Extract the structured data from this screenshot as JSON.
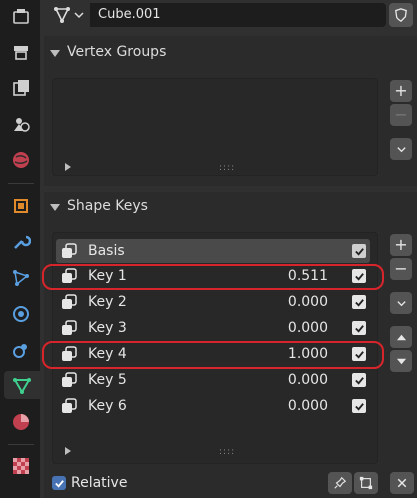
{
  "header": {
    "object_name": "Cube.001"
  },
  "tabs": [
    "tool-icon",
    "render-icon",
    "output-icon",
    "view-layer-icon",
    "scene-icon",
    "world-icon",
    "object-icon",
    "modifier-icon",
    "particles-icon",
    "physics-icon",
    "constraints-icon",
    "data-icon",
    "material-icon",
    "texture-icon"
  ],
  "vertex_groups": {
    "title": "Vertex Groups",
    "add": "+",
    "remove": "−",
    "menu": "⌄",
    "grip": "::::"
  },
  "shape_keys": {
    "title": "Shape Keys",
    "add": "+",
    "remove": "−",
    "grip": "::::",
    "rows": [
      {
        "name": "Basis",
        "value": "",
        "checked": true,
        "selected": true
      },
      {
        "name": "Key 1",
        "value": "0.511",
        "checked": true,
        "selected": false
      },
      {
        "name": "Key 2",
        "value": "0.000",
        "checked": true,
        "selected": false
      },
      {
        "name": "Key 3",
        "value": "0.000",
        "checked": true,
        "selected": false
      },
      {
        "name": "Key 4",
        "value": "1.000",
        "checked": true,
        "selected": false
      },
      {
        "name": "Key 5",
        "value": "0.000",
        "checked": true,
        "selected": false
      },
      {
        "name": "Key 6",
        "value": "0.000",
        "checked": true,
        "selected": false
      }
    ],
    "relative_label": "Relative",
    "relative_checked": true
  },
  "colors": {
    "highlight": "#d8252b",
    "accent": "#4772b3",
    "active_tab_icon": "#3fcf8e"
  }
}
